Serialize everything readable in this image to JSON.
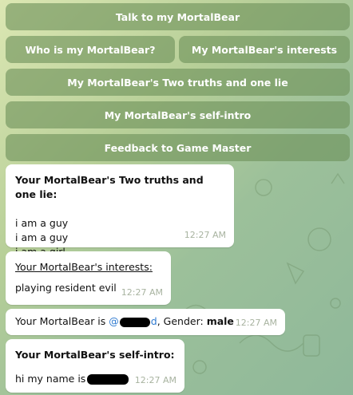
{
  "keyboard": {
    "talk": "Talk to my MortalBear",
    "who": "Who is my MortalBear?",
    "interests": "My MortalBear's interests",
    "two_truths": "My MortalBear's Two truths and one lie",
    "self_intro": "My MortalBear's self-intro",
    "feedback": "Feedback to Game Master"
  },
  "messages": {
    "truths": {
      "heading": "Your MortalBear's Two truths and one lie:",
      "lines": [
        "i am a guy",
        "i am a guy",
        "i am a girl"
      ],
      "time": "12:27 AM"
    },
    "interests": {
      "heading": "Your MortalBear's interests:",
      "body": "playing resident evil",
      "time": "12:27 AM"
    },
    "identity": {
      "prefix": "Your MortalBear is ",
      "mention_start": "@",
      "mention_end": "d",
      "gender_label": ", Gender: ",
      "gender_value": "male",
      "time": "12:27 AM"
    },
    "selfintro": {
      "heading": "Your MortalBear's self-intro:",
      "body": "hi my name is",
      "time": "12:27 AM"
    }
  }
}
